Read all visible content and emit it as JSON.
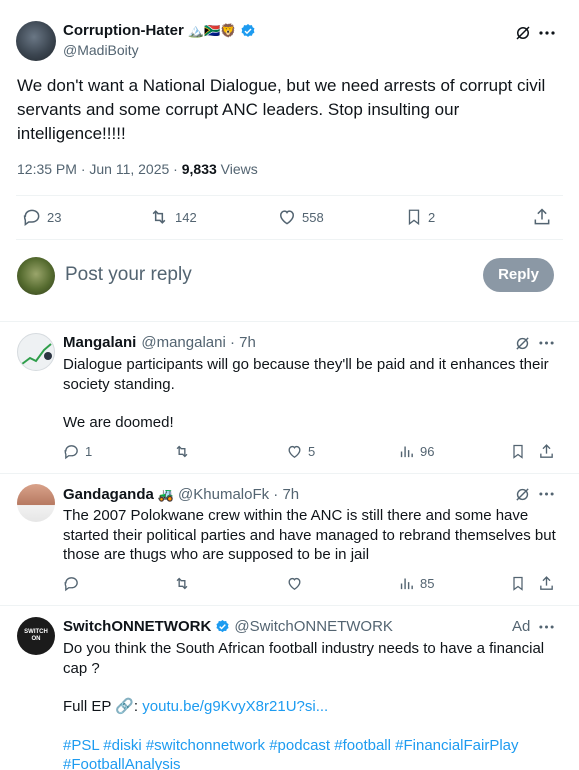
{
  "main_tweet": {
    "author": "Corruption-Hater",
    "author_emoji": "🏔️🇿🇦🦁",
    "handle": "@MadiBoity",
    "text": "We don't want a National Dialogue, but we need arrests of corrupt civil servants and some corrupt ANC leaders. Stop insulting our intelligence!!!!!",
    "timestamp": "12:35 PM · Jun 11, 2025 · ",
    "views_count": "9,833",
    "views_label": " Views",
    "replies": "23",
    "retweets": "142",
    "likes": "558",
    "bookmarks": "2"
  },
  "reply_box": {
    "placeholder": "Post your reply",
    "button_label": "Reply"
  },
  "replies": [
    {
      "name": "Mangalani",
      "handle": "@mangalani · 7h",
      "text_lines": [
        "Dialogue participants will go because they'll be paid and it enhances their",
        "society standing."
      ],
      "text2": "We are doomed!",
      "replies": "1",
      "retweets": "",
      "likes": "5",
      "views": "96"
    },
    {
      "name": "Gandaganda",
      "emoji": "🚜",
      "handle": "@KhumaloFk · 7h",
      "text_lines": [
        "The 2007 Polokwane crew within the ANC is still there and some have",
        "started their political parties and  have managed to rebrand themselves but",
        "those are thugs who are supposed to be in jail"
      ],
      "replies": "",
      "retweets": "",
      "likes": "",
      "views": "85"
    }
  ],
  "ad": {
    "name": "SwitchONNETWORK",
    "handle": "@SwitchONNETWORK",
    "label": "Ad",
    "avatar_text": "SWITCH ON",
    "text_lines": [
      "Do you think the South African football industry needs to have a financial",
      "cap ?"
    ],
    "full_ep_label": "Full EP 🔗: ",
    "link": "youtu.be/g9KvyX8r21U?si...",
    "hashtags_line1": "#PSL #diski #switchonnetwork #podcast #football #FinancialFairPlay",
    "hashtags_line2": "#FootballAnalysis"
  },
  "colors": {
    "accent": "#1d9bf0",
    "text": "#0f1419",
    "muted": "#536471",
    "border": "#eff3f4",
    "reply_button": "#8b98a5"
  }
}
